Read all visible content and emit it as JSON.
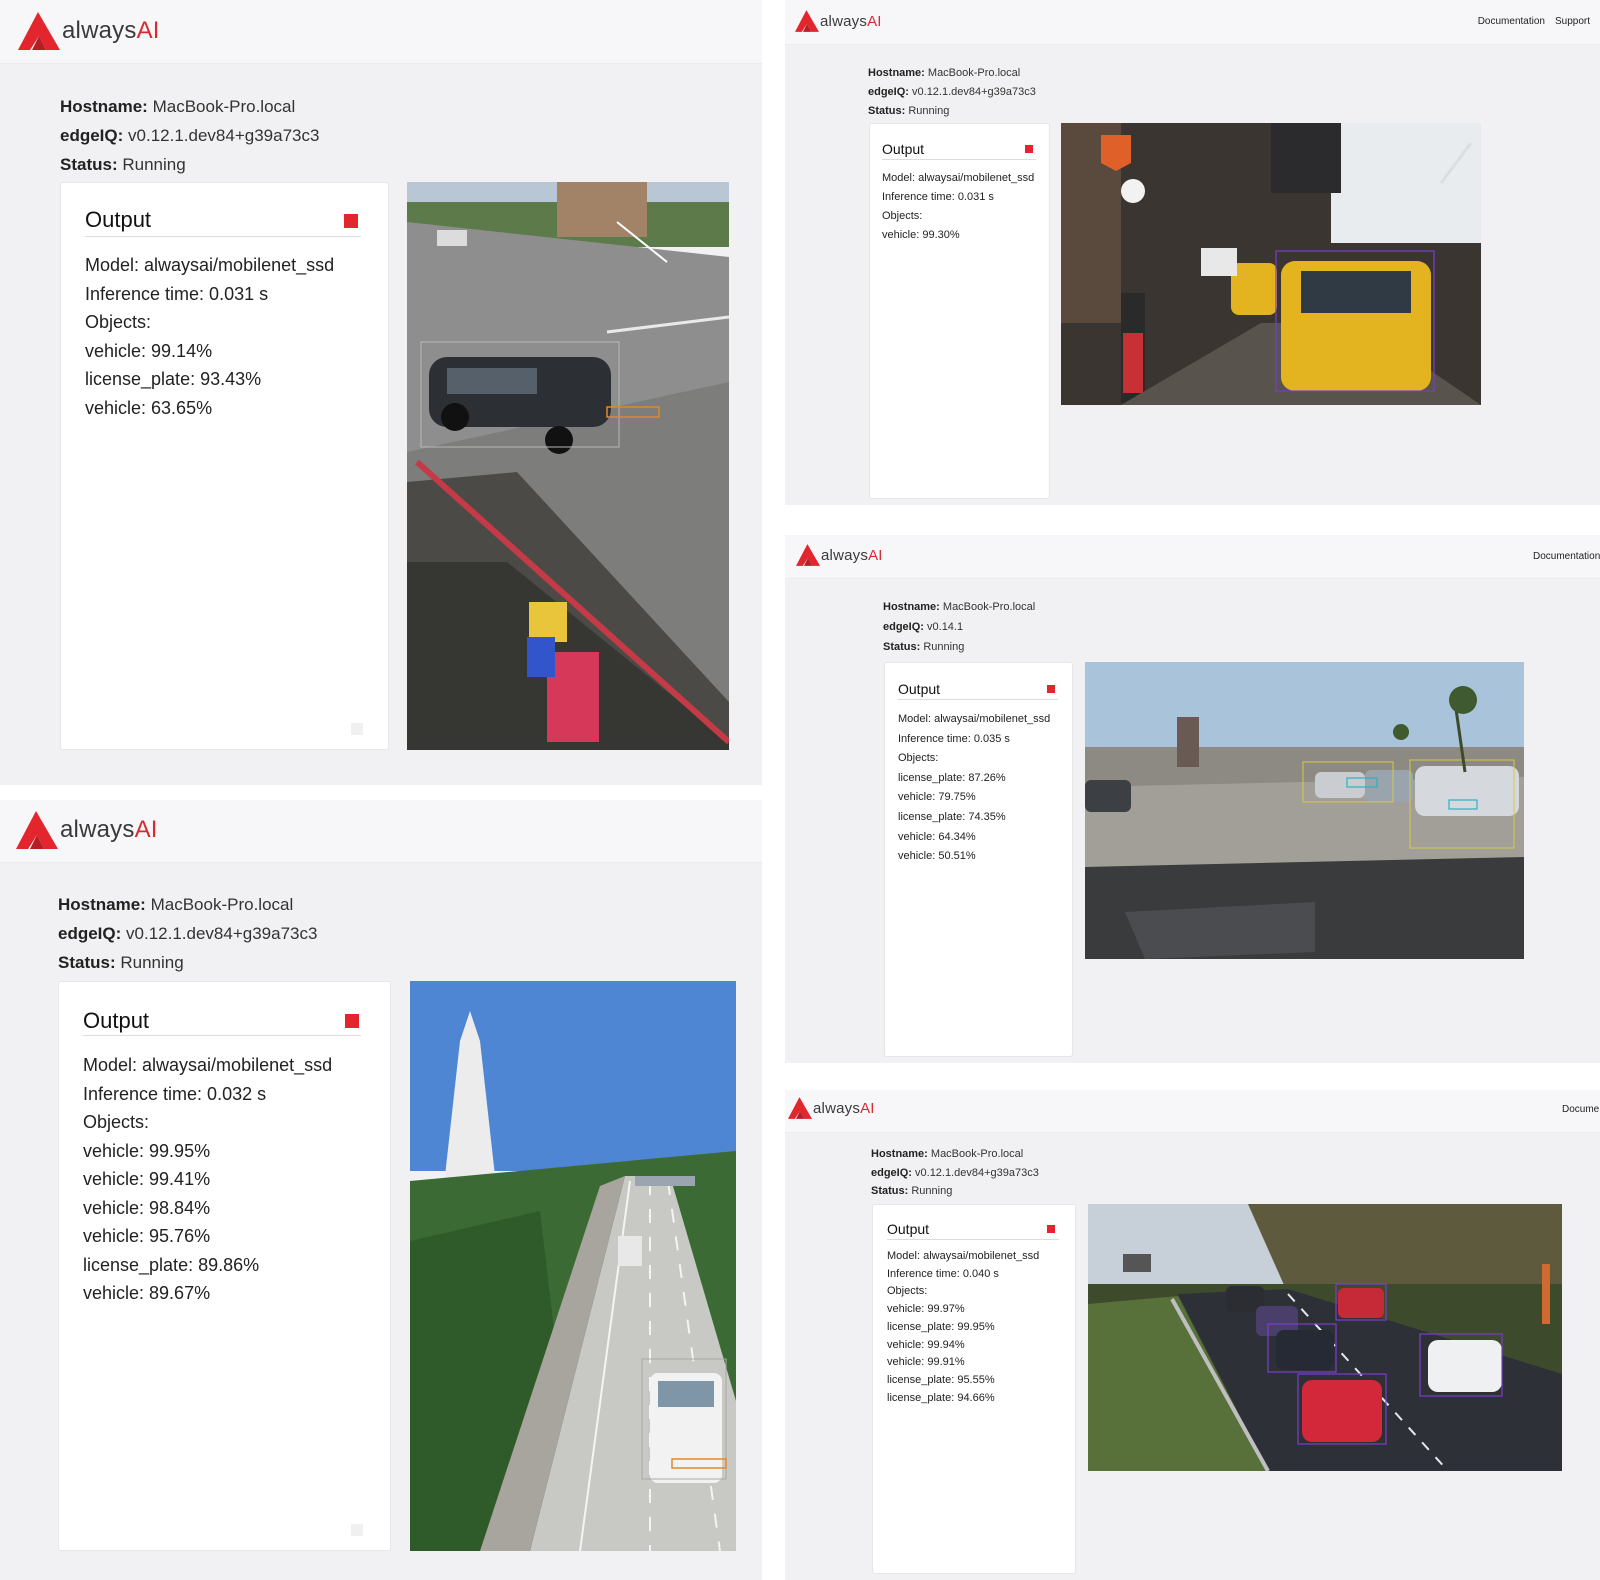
{
  "brand": {
    "name_prefix": "always",
    "name_suffix": "AI"
  },
  "nav": {
    "documentation": "Documentation",
    "support": "Support",
    "documentation_cut": "Documentation",
    "documentation_cut2": "Docume"
  },
  "labels": {
    "hostname": "Hostname:",
    "edgeiq": "edgeIQ:",
    "status": "Status:"
  },
  "panels": [
    {
      "hostname": "MacBook-Pro.local",
      "edgeiq": "v0.12.1.dev84+g39a73c3",
      "status": "Running",
      "output_title": "Output",
      "lines": [
        "Model: alwaysai/mobilenet_ssd",
        "Inference time: 0.031 s",
        "Objects:",
        "vehicle: 99.14%",
        "license_plate: 93.43%",
        "vehicle: 63.65%"
      ]
    },
    {
      "hostname": "MacBook-Pro.local",
      "edgeiq": "v0.12.1.dev84+g39a73c3",
      "status": "Running",
      "output_title": "Output",
      "lines": [
        "Model: alwaysai/mobilenet_ssd",
        "Inference time: 0.032 s",
        "Objects:",
        "vehicle: 99.95%",
        "vehicle: 99.41%",
        "vehicle: 98.84%",
        "vehicle: 95.76%",
        "license_plate: 89.86%",
        "vehicle: 89.67%"
      ]
    },
    {
      "hostname": "MacBook-Pro.local",
      "edgeiq": "v0.12.1.dev84+g39a73c3",
      "status": "Running",
      "output_title": "Output",
      "lines": [
        "Model: alwaysai/mobilenet_ssd",
        "Inference time: 0.031 s",
        "Objects:",
        "vehicle: 99.30%"
      ]
    },
    {
      "hostname": "MacBook-Pro.local",
      "edgeiq": "v0.14.1",
      "status": "Running",
      "output_title": "Output",
      "lines": [
        "Model: alwaysai/mobilenet_ssd",
        "Inference time: 0.035 s",
        "Objects:",
        "license_plate: 87.26%",
        "vehicle: 79.75%",
        "license_plate: 74.35%",
        "vehicle: 64.34%",
        "vehicle: 50.51%"
      ]
    },
    {
      "hostname": "MacBook-Pro.local",
      "edgeiq": "v0.12.1.dev84+g39a73c3",
      "status": "Running",
      "output_title": "Output",
      "lines": [
        "Model: alwaysai/mobilenet_ssd",
        "Inference time: 0.040 s",
        "Objects:",
        "vehicle: 99.97%",
        "license_plate: 99.95%",
        "vehicle: 99.94%",
        "vehicle: 99.91%",
        "license_plate: 95.55%",
        "license_plate: 94.66%"
      ]
    }
  ],
  "colors": {
    "accent": "#e3262e",
    "brand_text": "#3a3a3a",
    "panel_bg": "#f1f1f3",
    "topbar_bg": "#f7f7f9"
  }
}
